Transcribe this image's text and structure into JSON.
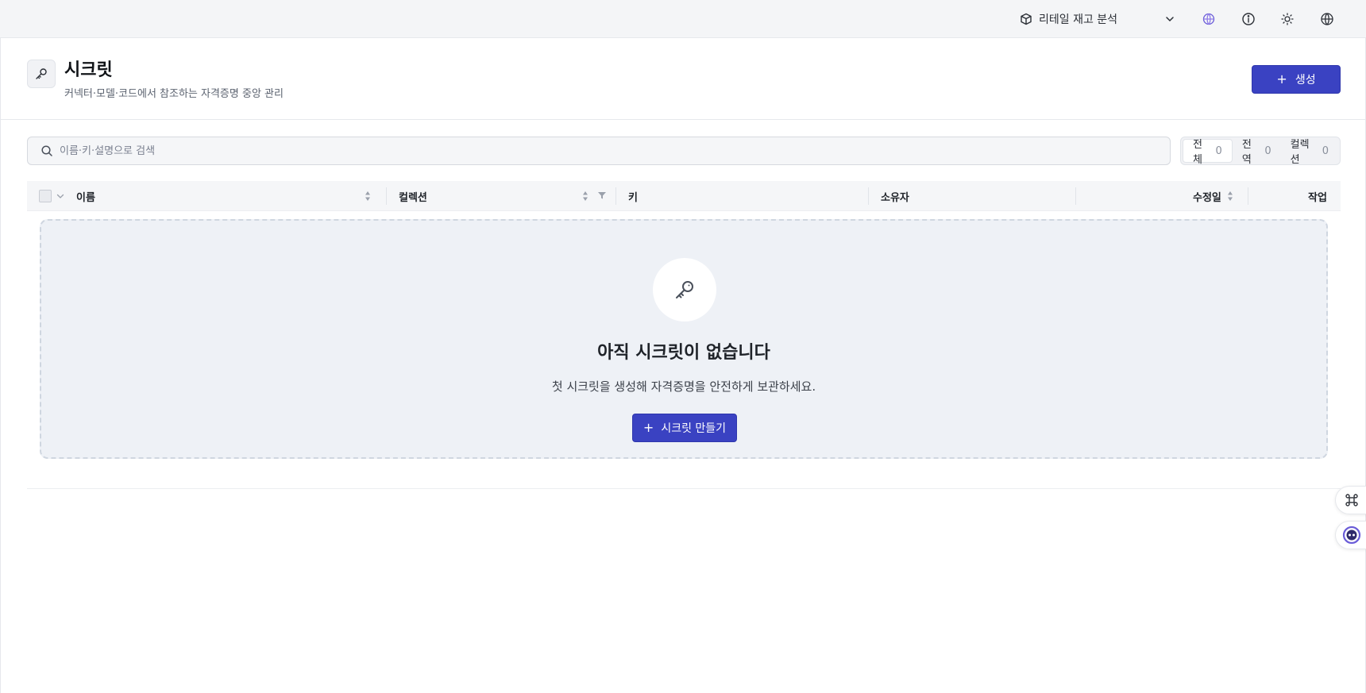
{
  "topbar": {
    "project_name": "리테일 재고 분석",
    "icons": [
      "cube-icon",
      "chevron-down-icon",
      "ai-globe-icon",
      "info-icon",
      "sun-icon",
      "language-icon"
    ]
  },
  "header": {
    "title": "시크릿",
    "subtitle": "커넥터·모델·코드에서 참조하는 자격증명 중앙 관리",
    "create_label": "생성"
  },
  "search": {
    "placeholder": "이름·키·설명으로 검색",
    "value": ""
  },
  "segments": [
    {
      "label": "전체",
      "count": "0",
      "active": true
    },
    {
      "label": "전역",
      "count": "0",
      "active": false
    },
    {
      "label": "컬렉션",
      "count": "0",
      "active": false
    }
  ],
  "table": {
    "columns": {
      "name": "이름",
      "collection": "컬렉션",
      "key": "키",
      "owner": "소유자",
      "modified": "수정일",
      "actions": "작업"
    },
    "rows": []
  },
  "empty": {
    "title": "아직 시크릿이 없습니다",
    "subtitle": "첫 시크릿을 생성해 자격증명을 안전하게 보관하세요.",
    "button_label": "시크릿 만들기"
  },
  "colors": {
    "primary": "#3a42c2",
    "empty_bg": "#eef1f6",
    "topbar_bg": "#f4f5f7"
  }
}
